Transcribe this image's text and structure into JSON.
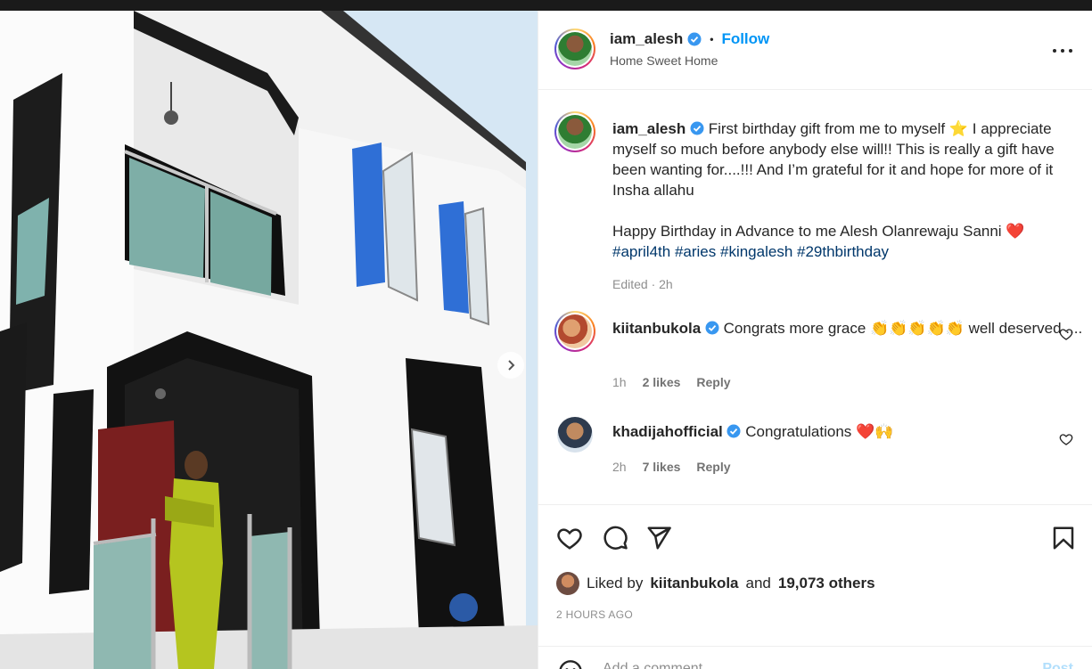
{
  "post": {
    "username": "iam_alesh",
    "follow_label": "Follow",
    "location": "Home Sweet Home",
    "separator": "•"
  },
  "caption": {
    "username": "iam_alesh",
    "text_part1": "First birthday gift from me to myself ⭐ I appreciate myself so much before anybody else will!! This is really a gift have been wanting for....!!! And I’m grateful for it and hope for more of it Insha allahu",
    "text_part2": "Happy Birthday in Advance to me Alesh Olanrewaju Sanni ❤️",
    "hashtags": [
      "#april4th",
      "#aries",
      "#kingalesh",
      "#29thbirthday"
    ],
    "meta": "Edited · 2h"
  },
  "comments": [
    {
      "username": "kiitanbukola",
      "text": "Congrats more grace 👏👏👏👏👏 well deserved ....",
      "time": "1h",
      "likes": "2 likes",
      "reply": "Reply"
    },
    {
      "username": "khadijahofficial",
      "text": "Congratulations ❤️🙌",
      "time": "2h",
      "likes": "7 likes",
      "reply": "Reply"
    }
  ],
  "likes_line": {
    "prefix": "Liked by",
    "user": "kiitanbukola",
    "middle": "and",
    "others": "19,073 others"
  },
  "time_ago": "2 HOURS AGO",
  "add_comment": {
    "placeholder": "Add a comment...",
    "post_label": "Post"
  },
  "colors": {
    "link": "#0095f6",
    "hashtag": "#00376b",
    "verified": "#3897f0"
  }
}
